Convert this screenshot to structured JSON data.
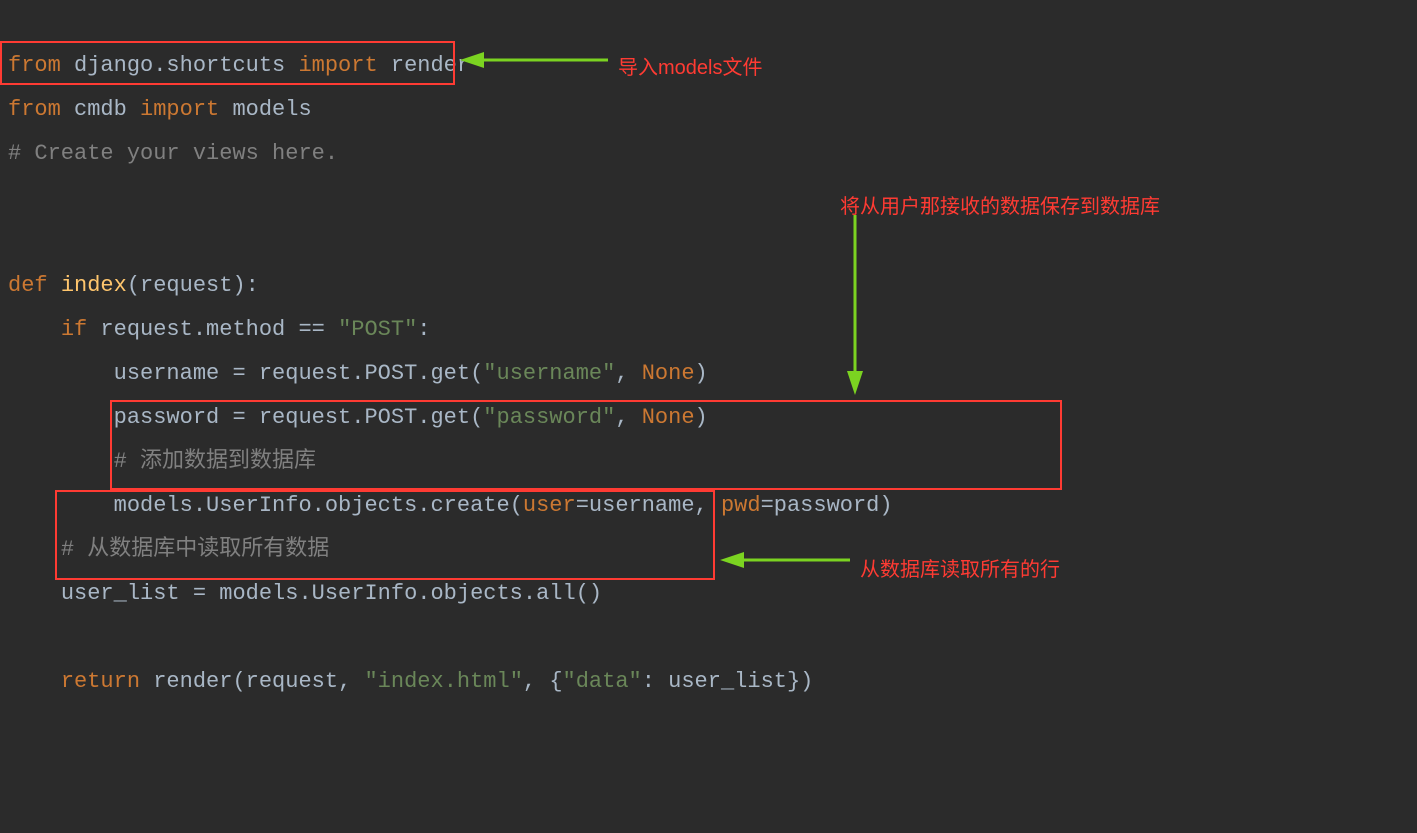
{
  "code": {
    "l1": {
      "from": "from",
      "mod": " django.shortcuts ",
      "imp": "import",
      "name": " render"
    },
    "l2": {
      "from": "from",
      "mod": " cmdb ",
      "imp": "import",
      "name": " models"
    },
    "l3": "# Create your views here.",
    "l5": {
      "def": "def ",
      "name": "index",
      "sig": "(request):"
    },
    "l6": {
      "indent": "    ",
      "if": "if",
      "expr": " request.method == ",
      "str": "\"POST\"",
      "colon": ":"
    },
    "l7": {
      "indent": "        ",
      "lhs": "username = request.POST.get(",
      "s": "\"username\"",
      "comma": ", ",
      "none": "None",
      "end": ")"
    },
    "l8": {
      "indent": "        ",
      "lhs": "password = request.POST.get(",
      "s": "\"password\"",
      "comma": ", ",
      "none": "None",
      "end": ")"
    },
    "l9": {
      "indent": "        ",
      "cmt": "# 添加数据到数据库"
    },
    "l10": {
      "indent": "        ",
      "a": "models.UserInfo.objects.create(",
      "p1": "user",
      "eq1": "=username, ",
      "p2": "pwd",
      "eq2": "=password)"
    },
    "l11": {
      "indent": "    ",
      "cmt": "# 从数据库中读取所有数据"
    },
    "l12": {
      "indent": "    ",
      "txt": "user_list = models.UserInfo.objects.all()"
    },
    "l14": {
      "indent": "    ",
      "ret": "return",
      "sp": " ",
      "fn": "render",
      "a": "(request, ",
      "s1": "\"index.html\"",
      "b": ", {",
      "s2": "\"data\"",
      "c": ": user_list})"
    }
  },
  "annotations": {
    "a1": "导入models文件",
    "a2": "将从用户那接收的数据保存到数据库",
    "a3": "从数据库读取所有的行"
  }
}
